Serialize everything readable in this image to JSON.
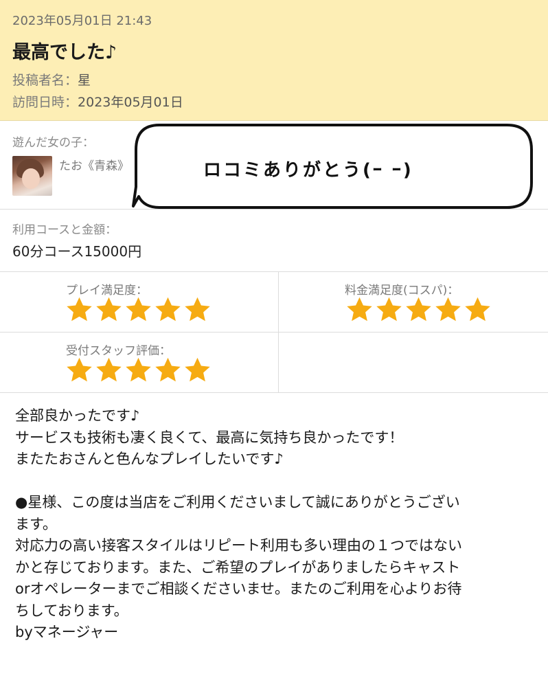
{
  "review": {
    "date": "2023年05月01日 21:43",
    "title": "最高でした♪",
    "poster_label": "投稿者名：",
    "poster_value": "星",
    "visit_label": "訪問日時：",
    "visit_value": "2023年05月01日"
  },
  "girl": {
    "label": "遊んだ女の子：",
    "name": "たお《青森》"
  },
  "bubble": {
    "text": "ロコミありがとう(ｰ ｰ)"
  },
  "course": {
    "label": "利用コースと金額：",
    "value": "60分コース15000円"
  },
  "ratings": [
    {
      "label": "プレイ満足度：",
      "stars": 5
    },
    {
      "label": "料金満足度(コスパ)：",
      "stars": 5
    },
    {
      "label": "受付スタッフ評価：",
      "stars": 5
    }
  ],
  "comment": {
    "lines": [
      "全部良かったです♪",
      "サービスも技術も凄く良くて、最高に気持ち良かったです！",
      "またたおさんと色んなプレイしたいです♪",
      "",
      "●星様、この度は当店をご利用くださいまして誠にありがとうござい",
      "ます。",
      "対応力の高い接客スタイルはリピート利用も多い理由の１つではない",
      "かと存じております。また、ご希望のプレイがありましたらキャスト",
      "orオペレーターまでご相談くださいませ。またのご利用を心よりお待",
      "ちしております。",
      "byマネージャー"
    ]
  },
  "colors": {
    "header_bg": "#fdeeb5",
    "star": "#f6ab12"
  },
  "icons": {
    "star": "star-icon",
    "avatar": "avatar"
  }
}
